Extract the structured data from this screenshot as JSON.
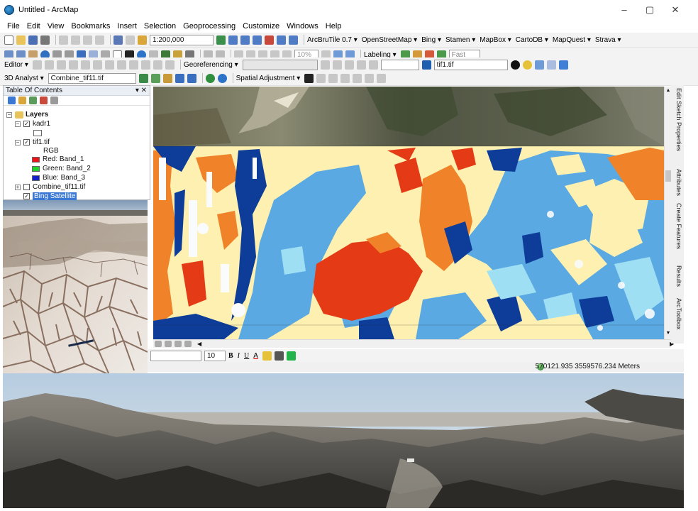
{
  "window": {
    "title": "Untitled - ArcMap",
    "minimize": "–",
    "maximize": "▢",
    "close": "✕"
  },
  "menu": [
    "File",
    "Edit",
    "View",
    "Bookmarks",
    "Insert",
    "Selection",
    "Geoprocessing",
    "Customize",
    "Windows",
    "Help"
  ],
  "toolbar1": {
    "scale": "1:200,000",
    "plugins": [
      "ArcBruTile 0.7 ▾",
      "OpenStreetMap ▾",
      "Bing ▾",
      "Stamen ▾",
      "MapBox ▾",
      "CartoDB ▾",
      "MapQuest ▾",
      "Strava ▾"
    ]
  },
  "toolbar2": {
    "zoom_value": "10%",
    "labeling": "Labeling ▾",
    "fast": "Fast"
  },
  "toolbar3": {
    "editor": "Editor ▾",
    "georeferencing": "Georeferencing ▾",
    "layer": "tif1.tif"
  },
  "toolbar4": {
    "analyst": "3D Analyst ▾",
    "layer": "Combine_tif11.tif",
    "spatial_adjustment": "Spatial Adjustment ▾"
  },
  "toc": {
    "title": "Table Of Contents",
    "header_controls": "▾ ✕",
    "root": "Layers",
    "layers": {
      "kadr1": "kadr1",
      "tif1": "tif1.tif",
      "rgb": "RGB",
      "red": "Red:   Band_1",
      "green": "Green: Band_2",
      "blue": "Blue:  Band_3",
      "combine": "Combine_tif11.tif",
      "bing": "Bing Satellite"
    },
    "band_colors": {
      "red": "#e8141a",
      "green": "#22d12b",
      "blue": "#1620c8"
    }
  },
  "dock_tabs": [
    "Edit Sketch Properties",
    "Attributes",
    "Create Features",
    "Results",
    "ArcToolbox"
  ],
  "draw_toolbar": {
    "font_size": "10",
    "bold": "B",
    "italic": "I",
    "underline": "U",
    "font_color": "A"
  },
  "status": {
    "coordinates": "570121.935  3559576.234 Meters"
  },
  "palette": {
    "ivory": "#fdf0b0",
    "sky": "#5aa9e3",
    "orange": "#f0822a",
    "red": "#e43a16",
    "navy": "#0d3c99",
    "cyan": "#9fdff4",
    "white": "#f9fbfc"
  }
}
